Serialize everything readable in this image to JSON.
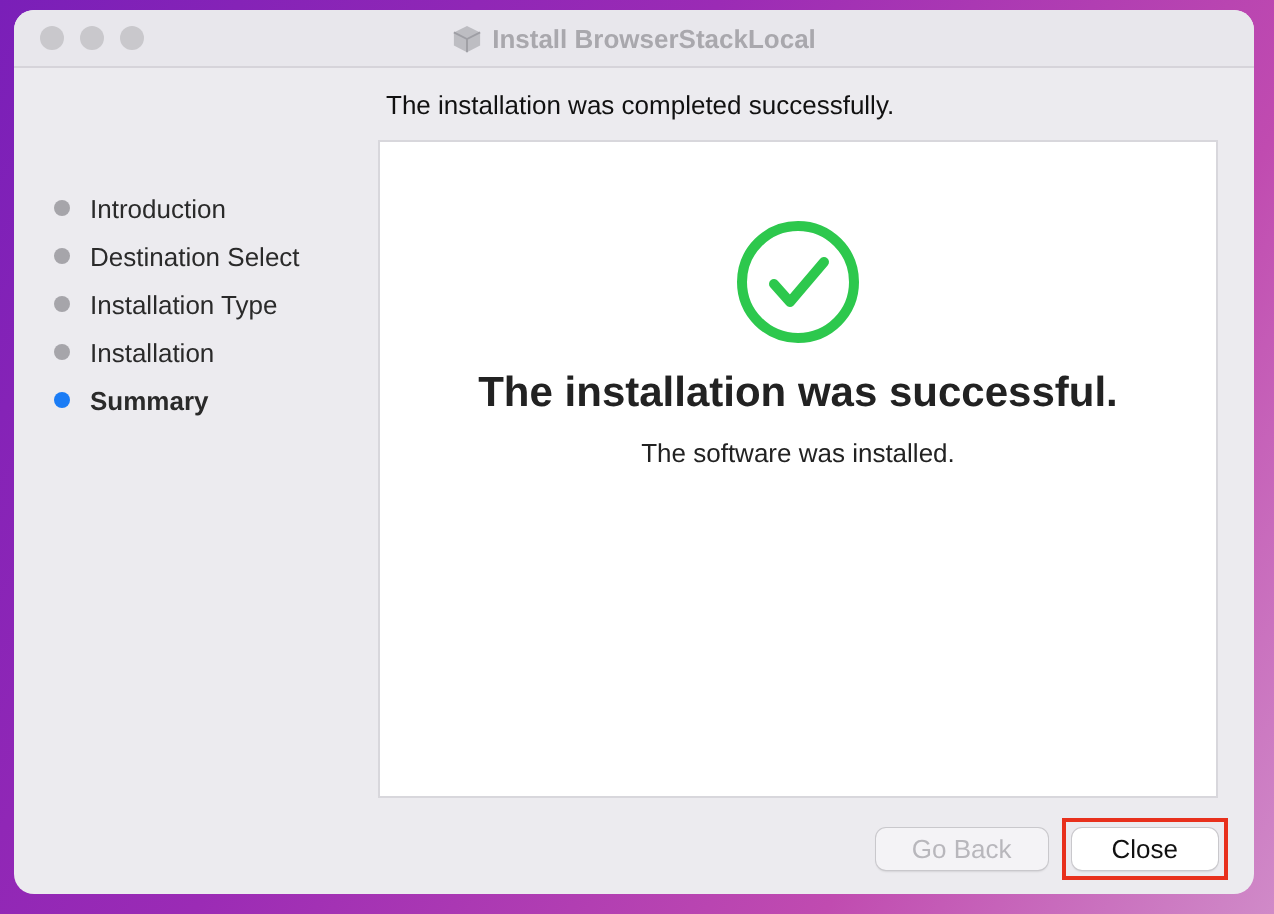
{
  "window": {
    "title": "Install BrowserStackLocal"
  },
  "steps": [
    {
      "label": "Introduction",
      "selected": false
    },
    {
      "label": "Destination Select",
      "selected": false
    },
    {
      "label": "Installation Type",
      "selected": false
    },
    {
      "label": "Installation",
      "selected": false
    },
    {
      "label": "Summary",
      "selected": true
    }
  ],
  "heading": "The installation was completed successfully.",
  "panel": {
    "title": "The installation was successful.",
    "message": "The software was installed."
  },
  "buttons": [
    {
      "label": "Go Back",
      "disabled": true,
      "highlighted": false
    },
    {
      "label": "Close",
      "disabled": false,
      "highlighted": true
    }
  ]
}
